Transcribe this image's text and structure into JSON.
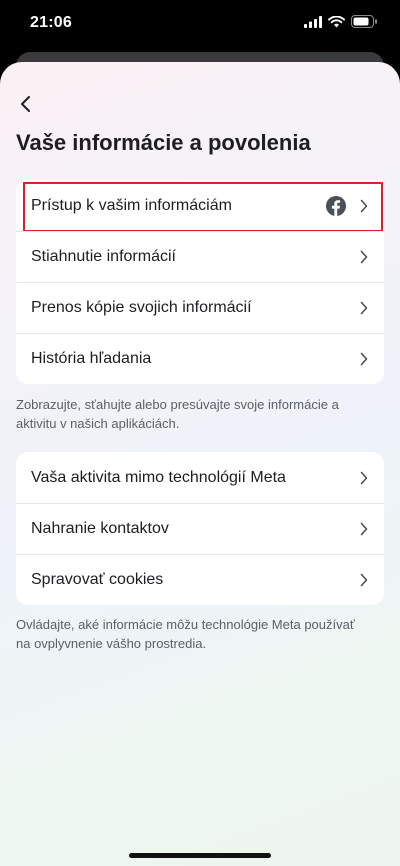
{
  "status_bar": {
    "time": "21:06"
  },
  "header": {
    "title": "Vaše informácie a povolenia"
  },
  "section_1": {
    "items": [
      {
        "label": "Prístup k vašim informáciám",
        "icon": "facebook-icon"
      },
      {
        "label": "Stiahnutie informácií"
      },
      {
        "label": "Prenos kópie svojich informácií"
      },
      {
        "label": "História hľadania"
      }
    ],
    "caption": "Zobrazujte, sťahujte alebo presúvajte svoje informácie a aktivitu v našich aplikáciách."
  },
  "section_2": {
    "items": [
      {
        "label": "Vaša aktivita mimo technológií Meta"
      },
      {
        "label": "Nahranie kontaktov"
      },
      {
        "label": "Spravovať cookies"
      }
    ],
    "caption": "Ovládajte, aké informácie môžu technológie Meta používať na ovplyvnenie vášho prostredia."
  },
  "colors": {
    "highlight_border": "#e0212c",
    "facebook_icon": "#4b4f56",
    "text_primary": "#1c1e21",
    "text_secondary": "#5b5f66"
  }
}
